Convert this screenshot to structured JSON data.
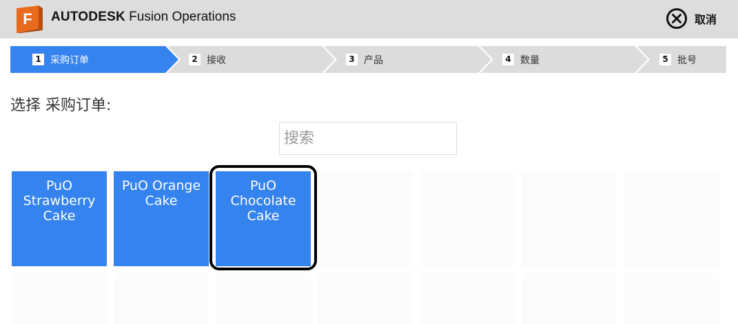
{
  "header": {
    "logo_letter": "F",
    "brand": "AUTODESK",
    "product": "Fusion Operations",
    "cancel_label": "取消",
    "cancel_icon": "close-circle-icon"
  },
  "steps": [
    {
      "num": "1",
      "label": "采购订单",
      "active": true
    },
    {
      "num": "2",
      "label": "接收",
      "active": false
    },
    {
      "num": "3",
      "label": "产品",
      "active": false
    },
    {
      "num": "4",
      "label": "数量",
      "active": false
    },
    {
      "num": "5",
      "label": "批号",
      "active": false
    }
  ],
  "colors": {
    "active_step": "#3583ee",
    "inactive_step": "#dcdcdc",
    "tile": "#3583ee",
    "header_bg": "#dddddd"
  },
  "main": {
    "prompt": "选择 采购订单:",
    "search_placeholder": "搜索"
  },
  "orders": [
    {
      "lines": [
        "PuO",
        "Strawberry",
        "Cake"
      ]
    },
    {
      "lines": [
        "PuO Orange",
        "Cake"
      ]
    },
    {
      "lines": [
        "PuO",
        "Chocolate",
        "Cake"
      ],
      "selected": true
    }
  ]
}
